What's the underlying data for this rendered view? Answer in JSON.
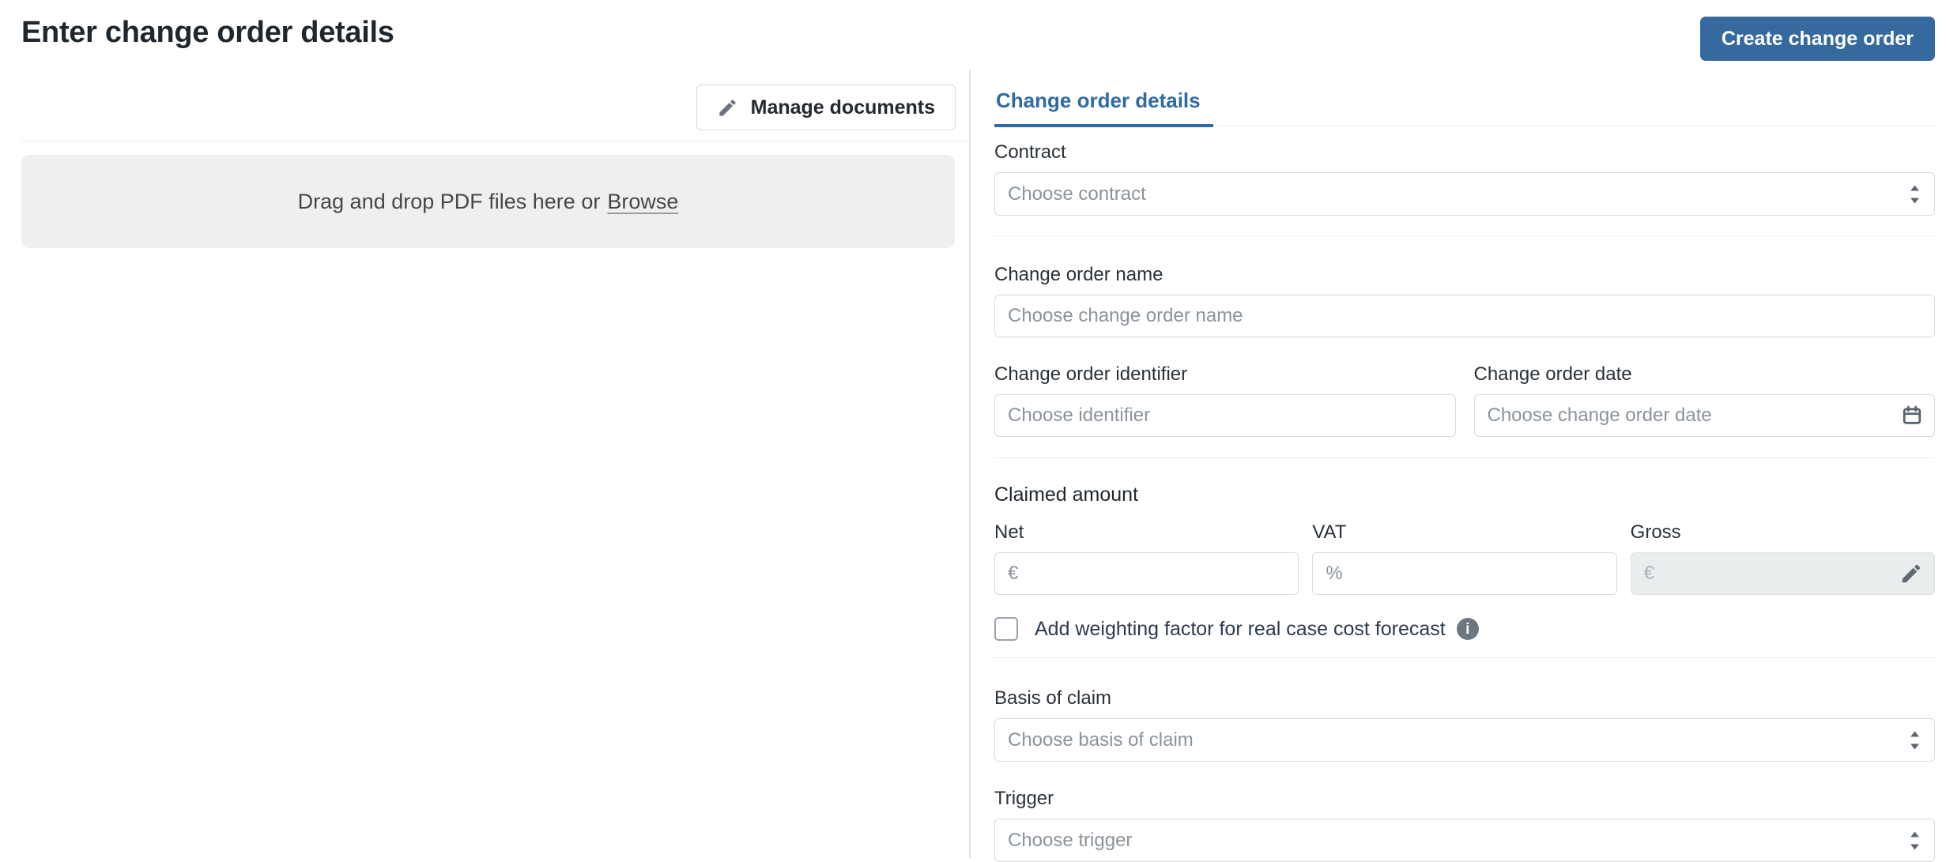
{
  "page": {
    "title": "Enter change order details"
  },
  "actions": {
    "create_change_order": "Create change order",
    "manage_documents": "Manage documents"
  },
  "documents": {
    "dropzone_text": "Drag and drop PDF files here or",
    "dropzone_link": "Browse"
  },
  "details": {
    "tab": "Change order details",
    "contract": {
      "label": "Contract",
      "placeholder": "Choose contract"
    },
    "name": {
      "label": "Change order name",
      "placeholder": "Choose change order name"
    },
    "identifier": {
      "label": "Change order identifier",
      "placeholder": "Choose identifier"
    },
    "date": {
      "label": "Change order date",
      "placeholder": "Choose change order date"
    },
    "claimed_amount": {
      "label": "Claimed amount",
      "net": {
        "label": "Net",
        "placeholder": "€"
      },
      "vat": {
        "label": "VAT",
        "placeholder": "%"
      },
      "gross": {
        "label": "Gross",
        "placeholder": "€"
      }
    },
    "weighting_checkbox": {
      "label": "Add weighting factor for real case cost forecast"
    },
    "basis": {
      "label": "Basis of claim",
      "placeholder": "Choose basis of claim"
    },
    "trigger": {
      "label": "Trigger",
      "placeholder": "Choose trigger"
    }
  },
  "icons": {
    "pencil": "edit-pencil",
    "calendar": "calendar",
    "info": "i",
    "select_arrows": "up-down-chevrons"
  },
  "colors": {
    "accent_blue": "#36699e",
    "tab_active_blue": "#2f6ba5",
    "dropzone_bg": "#f0efed",
    "disabled_field_bg": "#e9edee",
    "field_border": "#d7dadd",
    "placeholder_text": "#8b939b"
  }
}
